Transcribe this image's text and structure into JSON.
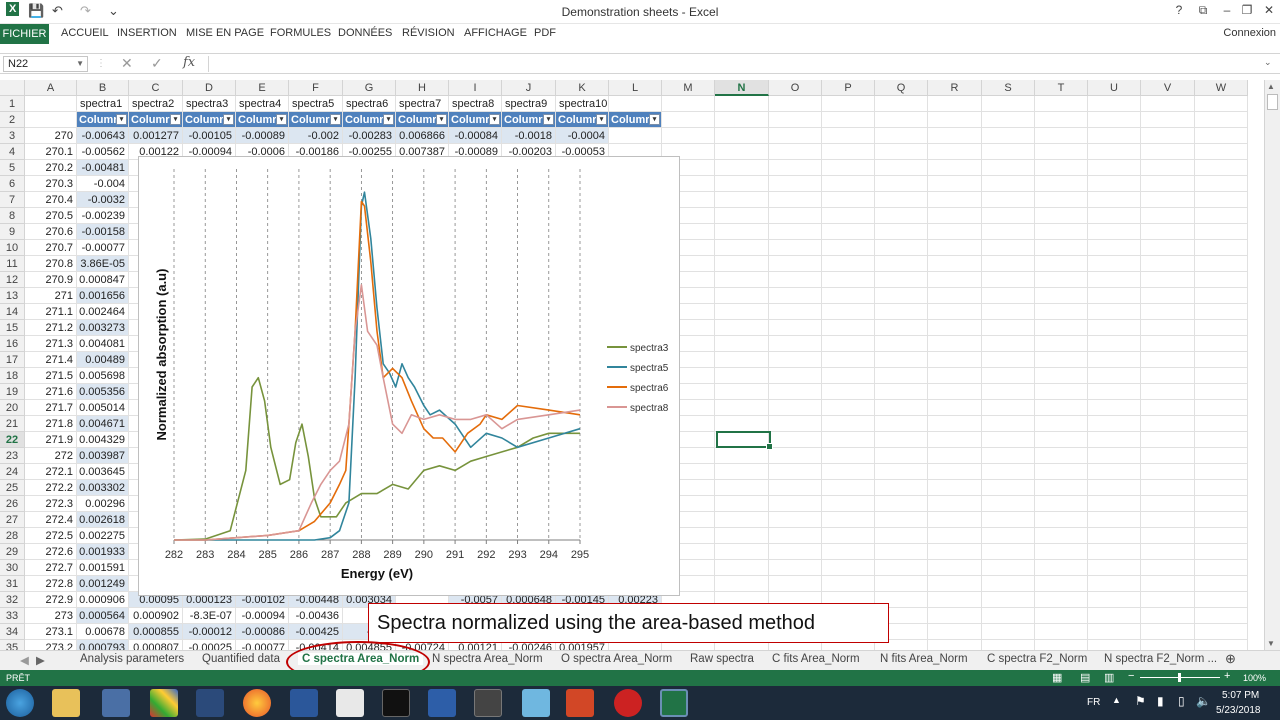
{
  "window": {
    "title": "Demonstration sheets - Excel",
    "help": "?",
    "min": "–",
    "restore": "❐",
    "close": "✕",
    "ribbon_display": "⧉"
  },
  "qat": {
    "excel_icon": "X",
    "save_icon": "💾",
    "undo_icon": "↶",
    "redo_icon": "↷",
    "customize": "⌄"
  },
  "ribbon": {
    "file": "FICHIER",
    "tabs": [
      "ACCUEIL",
      "INSERTION",
      "MISE EN PAGE",
      "FORMULES",
      "DONNÉES",
      "RÉVISION",
      "AFFICHAGE",
      "PDF"
    ],
    "account": "Connexion"
  },
  "formula_bar": {
    "name_box": "N22",
    "cancel": "✕",
    "enter": "✓",
    "fx": "fx",
    "value": ""
  },
  "columns": [
    "A",
    "B",
    "C",
    "D",
    "E",
    "F",
    "G",
    "H",
    "I",
    "J",
    "K",
    "L",
    "M",
    "N",
    "O",
    "P",
    "Q",
    "R",
    "S",
    "T",
    "U",
    "V",
    "W"
  ],
  "selected_column": "N",
  "selected_row": "22",
  "rows": [
    "1",
    "2",
    "3",
    "4",
    "5",
    "6",
    "7",
    "8",
    "9",
    "10",
    "11",
    "12",
    "13",
    "14",
    "15",
    "16",
    "17",
    "18",
    "19",
    "20",
    "21",
    "22",
    "23",
    "24",
    "25",
    "26",
    "27",
    "28",
    "29",
    "30",
    "31",
    "32",
    "33",
    "34",
    "35"
  ],
  "header_row": [
    "spectra1",
    "spectra2",
    "spectra3",
    "spectra4",
    "spectra5",
    "spectra6",
    "spectra7",
    "spectra8",
    "spectra9",
    "spectra10"
  ],
  "table_headers": [
    "Columr",
    "Columr",
    "Columr",
    "Columr",
    "Columr",
    "Columr",
    "Columr",
    "Columr",
    "Columr",
    "Columr",
    "Columr"
  ],
  "row3": [
    "270",
    "-0.00643",
    "0.001277",
    "-0.00105",
    "-0.00089",
    "-0.002",
    "-0.00283",
    "0.006866",
    "-0.00084",
    "-0.0018",
    "-0.0004"
  ],
  "row4": [
    "270.1",
    "-0.00562",
    "0.00122",
    "-0.00094",
    "-0.0006",
    "-0.00186",
    "-0.00255",
    "0.007387",
    "-0.00089",
    "-0.00203",
    "-0.00053"
  ],
  "col_a": [
    "270.2",
    "270.3",
    "270.4",
    "270.5",
    "270.6",
    "270.7",
    "270.8",
    "270.9",
    "271",
    "271.1",
    "271.2",
    "271.3",
    "271.4",
    "271.5",
    "271.6",
    "271.7",
    "271.8",
    "271.9",
    "272",
    "272.1",
    "272.2",
    "272.3",
    "272.4",
    "272.5",
    "272.6",
    "272.7",
    "272.8",
    "272.9",
    "273",
    "273.1",
    "273.2"
  ],
  "col_b": [
    "-0.00481",
    "-0.004",
    "-0.0032",
    "-0.00239",
    "-0.00158",
    "-0.00077",
    "3.86E-05",
    "0.000847",
    "0.001656",
    "0.002464",
    "0.003273",
    "0.004081",
    "0.00489",
    "0.005698",
    "0.005356",
    "0.005014",
    "0.004671",
    "0.004329",
    "0.003987",
    "0.003645",
    "0.003302",
    "0.00296",
    "0.002618",
    "0.002275",
    "0.001933",
    "0.001591",
    "0.001249",
    "0.000906",
    "0.000564",
    "0.00678",
    "0.000793"
  ],
  "row32": [
    "0.00095",
    "0.000123",
    "-0.00102",
    "-0.00448",
    "0.003034",
    "",
    "-0.0057",
    "0.000648",
    "-0.00145",
    "0.00223"
  ],
  "row33": [
    "0.000902",
    "-8.3E-07",
    "-0.00094",
    "-0.00436",
    "0.00",
    ""
  ],
  "row34": [
    "0.000855",
    "-0.00012",
    "-0.00086",
    "-0.00425",
    "-0.00",
    ""
  ],
  "row35": [
    "0.000807",
    "-0.00025",
    "-0.00077",
    "-0.00414",
    "0.004855",
    "-0.00724",
    "0.00121",
    "-0.00246",
    "0.001957"
  ],
  "annotation": "Spectra normalized using the area-based method",
  "sheet_tabs": [
    "Analysis parameters",
    "Quantified data",
    "C spectra Area_Norm",
    "N spectra Area_Norm",
    "O spectra Area_Norm",
    "Raw spectra",
    "C fits Area_Norm",
    "N fits Area_Norm",
    "C spectra F2_Norm",
    "N spectra F2_Norm ..."
  ],
  "active_sheet": "C spectra Area_Norm",
  "status": {
    "left": "PRÊT",
    "zoom": "100%"
  },
  "taskbar": {
    "lang": "FR",
    "time": "5:07 PM",
    "date": "5/23/2018"
  },
  "colors": {
    "excel_green": "#217346",
    "table_blue": "#4f81bd",
    "band": "#dce6f1",
    "spectra3": "#77933c",
    "spectra5": "#31859c",
    "spectra6": "#e46c0a",
    "spectra8": "#d99694"
  },
  "chart_data": {
    "type": "line",
    "title": "",
    "xlabel": "Energy (eV)",
    "ylabel": "Normalized absorption (a.u)",
    "xlim": [
      282,
      295
    ],
    "ticks": [
      "282",
      "283",
      "284",
      "285",
      "286",
      "287",
      "288",
      "289",
      "290",
      "291",
      "292",
      "293",
      "294",
      "295"
    ],
    "legend_position": "right",
    "grid": "vertical dashed",
    "series": [
      {
        "name": "spectra3",
        "color": "#77933c",
        "x": [
          282,
          283,
          283.8,
          284.3,
          284.5,
          284.7,
          284.9,
          285.1,
          285.4,
          285.7,
          285.9,
          286.1,
          286.3,
          286.5,
          286.7,
          286.9,
          287.2,
          287.5,
          288,
          288.5,
          289,
          289.5,
          290,
          290.5,
          291,
          291.5,
          292,
          292.5,
          293,
          293.5,
          294,
          295
        ],
        "y": [
          0,
          0.002,
          0.02,
          0.15,
          0.33,
          0.35,
          0.3,
          0.2,
          0.12,
          0.13,
          0.21,
          0.25,
          0.18,
          0.09,
          0.05,
          0.05,
          0.05,
          0.08,
          0.1,
          0.1,
          0.12,
          0.11,
          0.15,
          0.16,
          0.15,
          0.17,
          0.18,
          0.19,
          0.2,
          0.22,
          0.23,
          0.23
        ]
      },
      {
        "name": "spectra5",
        "color": "#31859c",
        "x": [
          282,
          283,
          284,
          285,
          286,
          286.5,
          287,
          287.3,
          287.6,
          287.8,
          288,
          288.1,
          288.3,
          288.5,
          288.7,
          288.9,
          289.1,
          289.3,
          289.5,
          289.7,
          290,
          290.2,
          290.5,
          291,
          291.5,
          292,
          292.5,
          293,
          294,
          295
        ],
        "y": [
          0,
          0,
          0,
          0,
          0,
          0,
          0.005,
          0.02,
          0.08,
          0.35,
          0.72,
          0.75,
          0.65,
          0.5,
          0.38,
          0.36,
          0.33,
          0.38,
          0.35,
          0.33,
          0.29,
          0.27,
          0.28,
          0.25,
          0.2,
          0.23,
          0.22,
          0.2,
          0.22,
          0.24
        ]
      },
      {
        "name": "spectra6",
        "color": "#e46c0a",
        "x": [
          282,
          283,
          284,
          285,
          286,
          286.5,
          287,
          287.3,
          287.5,
          287.8,
          288,
          288.1,
          288.3,
          288.5,
          288.7,
          289,
          289.3,
          289.6,
          290,
          290.3,
          290.6,
          291,
          291.4,
          291.8,
          292,
          292.5,
          293,
          294,
          295
        ],
        "y": [
          0,
          0,
          0.005,
          0.01,
          0.02,
          0.04,
          0.08,
          0.12,
          0.15,
          0.45,
          0.73,
          0.72,
          0.6,
          0.45,
          0.35,
          0.37,
          0.35,
          0.3,
          0.24,
          0.22,
          0.22,
          0.19,
          0.23,
          0.25,
          0.27,
          0.26,
          0.29,
          0.28,
          0.27
        ]
      },
      {
        "name": "spectra8",
        "color": "#d99694",
        "x": [
          282,
          283,
          284,
          285,
          286,
          286.4,
          286.7,
          287,
          287.3,
          287.6,
          287.8,
          288,
          288.2,
          288.5,
          288.7,
          289,
          289.3,
          289.6,
          290,
          290.5,
          291,
          291.5,
          292,
          292.5,
          293,
          294,
          295
        ],
        "y": [
          0,
          0,
          0.005,
          0.01,
          0.02,
          0.08,
          0.12,
          0.15,
          0.17,
          0.25,
          0.45,
          0.55,
          0.45,
          0.42,
          0.35,
          0.25,
          0.23,
          0.27,
          0.26,
          0.27,
          0.26,
          0.26,
          0.27,
          0.24,
          0.26,
          0.27,
          0.28
        ]
      }
    ]
  }
}
